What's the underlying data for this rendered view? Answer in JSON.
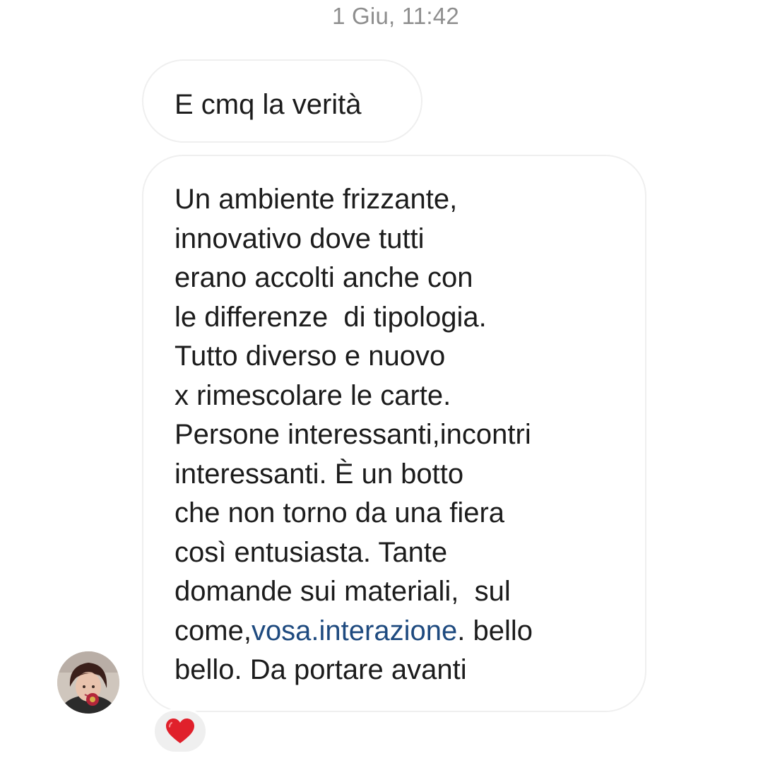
{
  "thread": {
    "timestamp": "1 Giu, 11:42"
  },
  "messages": [
    {
      "lines": [
        {
          "parts": [
            {
              "text": "E cmq la verità"
            }
          ]
        }
      ]
    },
    {
      "lines": [
        {
          "parts": [
            {
              "text": "Un ambiente frizzante,"
            }
          ]
        },
        {
          "parts": [
            {
              "text": "innovativo dove tutti"
            }
          ]
        },
        {
          "parts": [
            {
              "text": "erano accolti anche con"
            }
          ]
        },
        {
          "parts": [
            {
              "text": "le differenze  di tipologia."
            }
          ]
        },
        {
          "parts": [
            {
              "text": "Tutto diverso e nuovo"
            }
          ]
        },
        {
          "parts": [
            {
              "text": "x rimescolare le carte."
            }
          ]
        },
        {
          "parts": [
            {
              "text": "Persone interessanti,incontri"
            }
          ]
        },
        {
          "parts": [
            {
              "text": "interessanti. È un botto"
            }
          ]
        },
        {
          "parts": [
            {
              "text": "che non torno da una fiera"
            }
          ]
        },
        {
          "parts": [
            {
              "text": "così entusiasta. Tante"
            }
          ]
        },
        {
          "parts": [
            {
              "text": "domande sui materiali,  sul"
            }
          ]
        },
        {
          "parts": [
            {
              "text": "come,"
            },
            {
              "text": "vosa.interazione",
              "link": true
            },
            {
              "text": ". bello"
            }
          ]
        },
        {
          "parts": [
            {
              "text": "bello. Da portare avanti"
            }
          ]
        }
      ]
    }
  ],
  "reaction": {
    "icon": "red-heart-icon",
    "color": "#e0202b"
  },
  "colors": {
    "timestamp": "#8e8e8e",
    "text": "#1c1c1c",
    "link": "#1e4a7f",
    "bubble_border": "#efefef",
    "reaction_bg": "#efefef"
  }
}
